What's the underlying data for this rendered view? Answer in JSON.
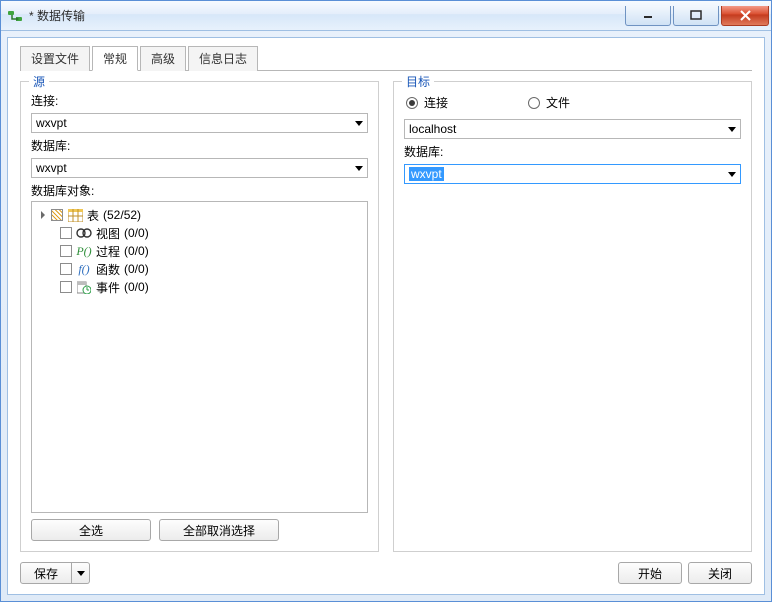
{
  "window": {
    "title": "* 数据传输"
  },
  "tabs": {
    "settings": "设置文件",
    "general": "常规",
    "advanced": "高级",
    "log": "信息日志",
    "active": "general"
  },
  "source": {
    "group_title": "源",
    "connection_label": "连接:",
    "connection_value": "wxvpt",
    "database_label": "数据库:",
    "database_value": "wxvpt",
    "objects_label": "数据库对象:",
    "tree": {
      "tables": {
        "label": "表",
        "count": "(52/52)"
      },
      "views": {
        "label": "视图",
        "count": "(0/0)"
      },
      "procs": {
        "label": "过程",
        "count": "(0/0)"
      },
      "funcs": {
        "label": "函数",
        "count": "(0/0)"
      },
      "events": {
        "label": "事件",
        "count": "(0/0)"
      }
    },
    "buttons": {
      "select_all": "全选",
      "deselect_all": "全部取消选择"
    }
  },
  "target": {
    "group_title": "目标",
    "radio_connection": "连接",
    "radio_file": "文件",
    "connection_value": "localhost",
    "database_label": "数据库:",
    "database_value": "wxvpt"
  },
  "footer": {
    "save": "保存",
    "start": "开始",
    "close": "关闭"
  }
}
